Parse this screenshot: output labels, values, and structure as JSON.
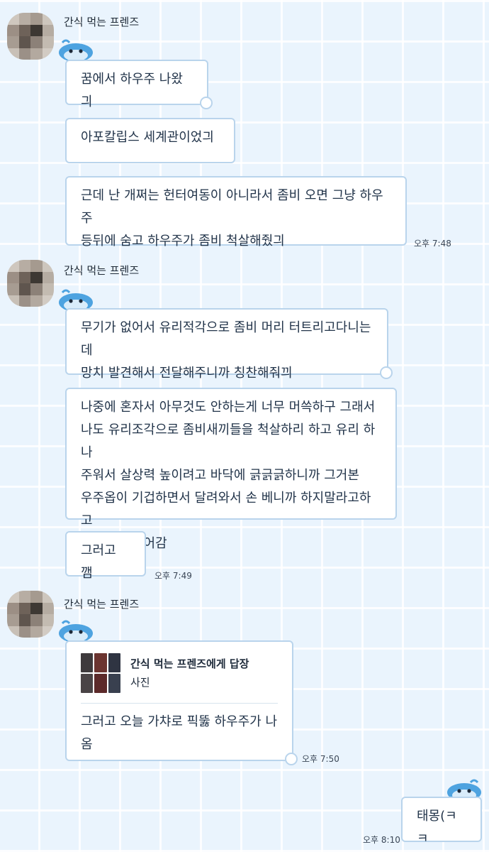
{
  "messages": {
    "sender_name": "간식 먹는 프렌즈",
    "g1": {
      "b1": "꿈에서 하우주 나왔긔",
      "b2": "아포칼립스 세계관이었긔",
      "b3_line1": "근데 난 개쩌는 헌터여동이 아니라서 좀비 오면 그냥 하우주",
      "b3_line2": "등뒤에 숨고 하우주가 좀비 척살해줬긔",
      "time": "오후 7:48"
    },
    "g2": {
      "b1_line1": "무기가 없어서 유리적각으로 좀비 머리 터트리고다니는데",
      "b1_line2": "망치 발견해서 전달해주니까 칭찬해줘끠",
      "b2_lines": [
        "나중에 혼자서 아무것도 안하는게 너무 머쓱하구 그래서",
        "나도 유리조각으로 좀비새끼들을 척살하리 하고 유리 하나",
        "주워서 살상력 높이려고 바닥에 긁긁긁하니까 그거본",
        "우주옵이 기겁하면서 달려와서 손 베니까 하지말라고하고",
        "유리조각 뺐어감"
      ],
      "b3": "그러고 깸",
      "time": "오후 7:49"
    },
    "g3": {
      "reply_title": "간식 먹는 프렌즈에게 답장",
      "reply_sub": "사진",
      "text": "그러고 오늘 가챠로 픽뚫 하우주가 나옴",
      "time": "오후 7:50"
    },
    "mine": {
      "text": "태몽(ㅋㅋ",
      "time": "오후 8:10"
    }
  },
  "icons": {
    "avatar": "pixelated-avatar",
    "mascot": "blue-whale-mascot-icon",
    "reply_thumb": "photo-thumbnail"
  },
  "colors": {
    "background": "#eaf4fd",
    "bubble_border": "#b9d4ec",
    "mascot_blue": "#4ea3e0"
  }
}
